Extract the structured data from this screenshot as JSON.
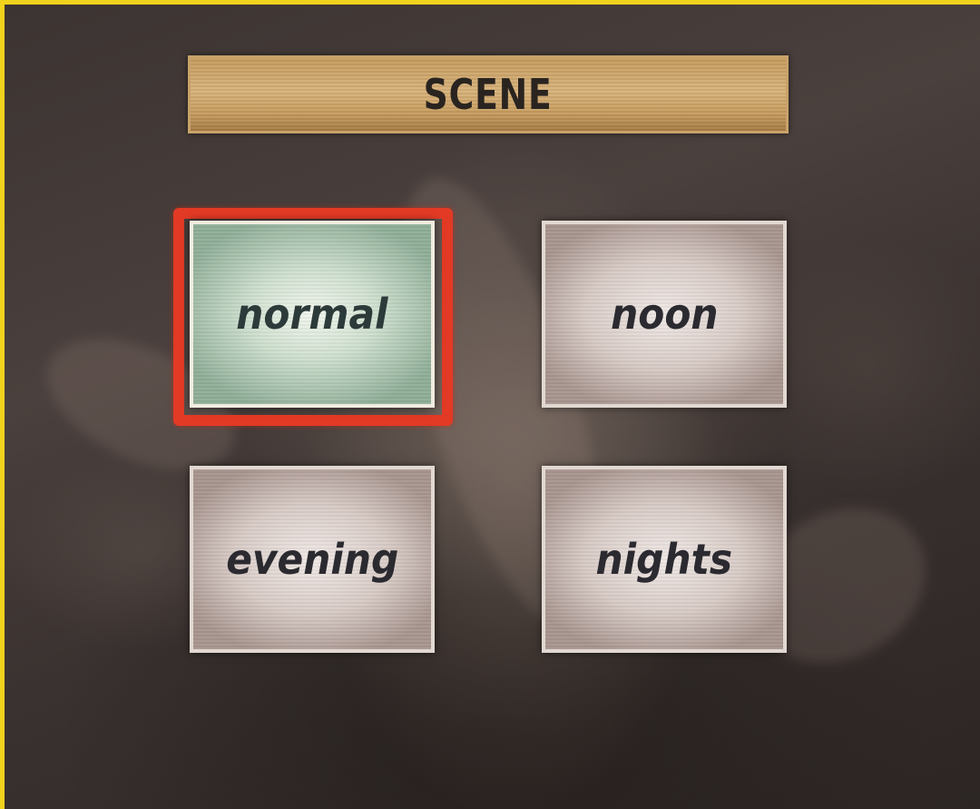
{
  "menu": {
    "title": "SCENE",
    "selected": "normal",
    "options": [
      {
        "id": "normal",
        "label": "normal"
      },
      {
        "id": "noon",
        "label": "noon"
      },
      {
        "id": "evening",
        "label": "evening"
      },
      {
        "id": "nights",
        "label": "nights"
      }
    ]
  },
  "colors": {
    "frame_border": "#f1d21c",
    "selection_ring": "#e23a25",
    "title_bar": "#d8b27a",
    "button_face": "#d8cbc6",
    "selected_button_face": "#cfe0cf"
  }
}
